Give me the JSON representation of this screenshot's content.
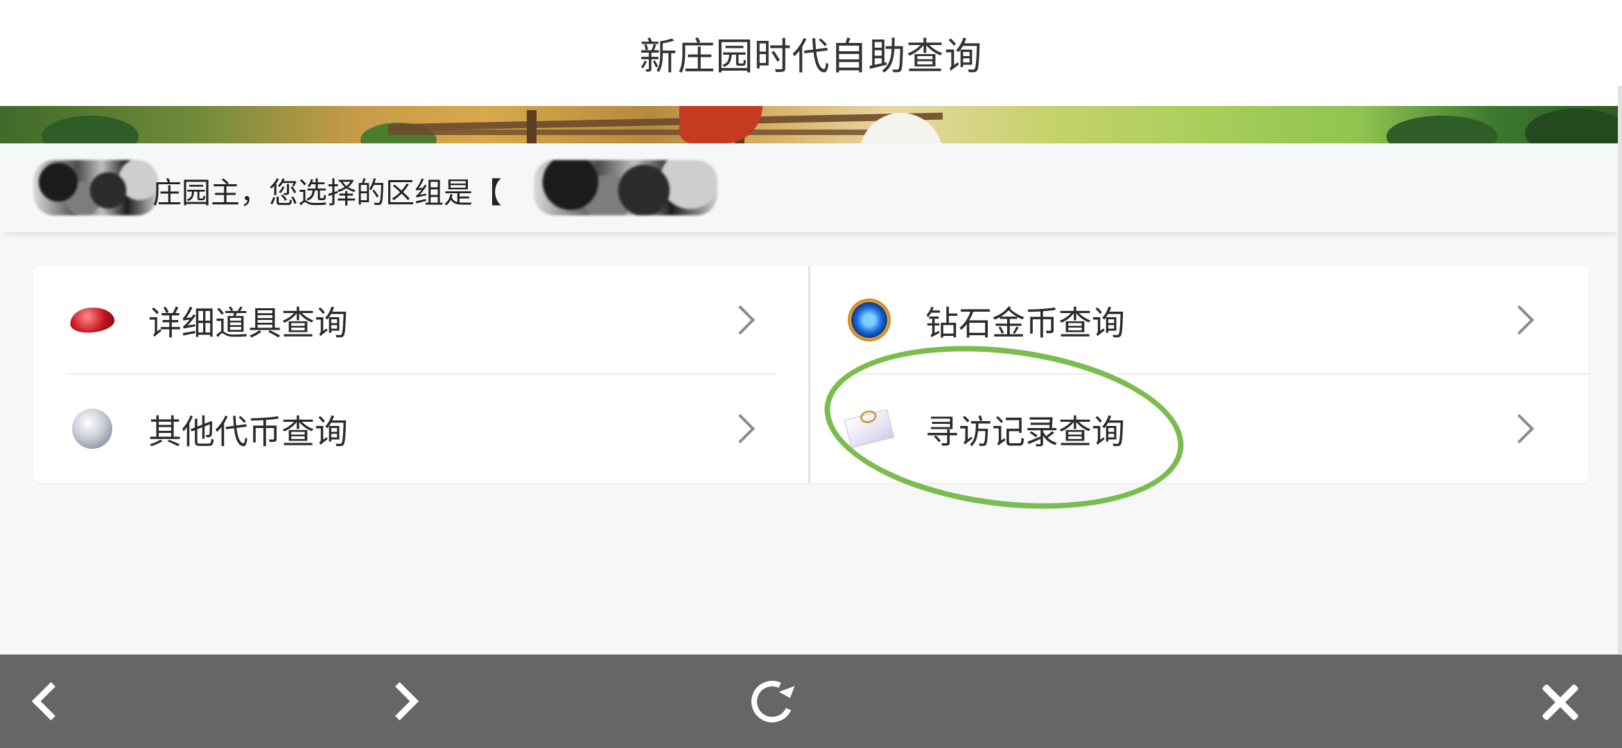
{
  "header": {
    "title": "新庄园时代自助查询"
  },
  "notice": {
    "text": "庄园主，您选择的区组是【"
  },
  "menu": {
    "items": [
      {
        "label": "详细道具查询",
        "icon": "red-gem-icon"
      },
      {
        "label": "钻石金币查询",
        "icon": "blue-diamond-coin-icon"
      },
      {
        "label": "其他代币查询",
        "icon": "silver-coin-icon"
      },
      {
        "label": "寻访记录查询",
        "icon": "letter-envelope-icon"
      }
    ]
  },
  "toolbar": {
    "back": "back-icon",
    "forward": "forward-icon",
    "refresh": "refresh-icon",
    "close": "close-icon"
  },
  "colors": {
    "annotation_circle": "#79bd4e",
    "toolbar_bg": "#666666",
    "page_bg": "#f6f7f9"
  }
}
